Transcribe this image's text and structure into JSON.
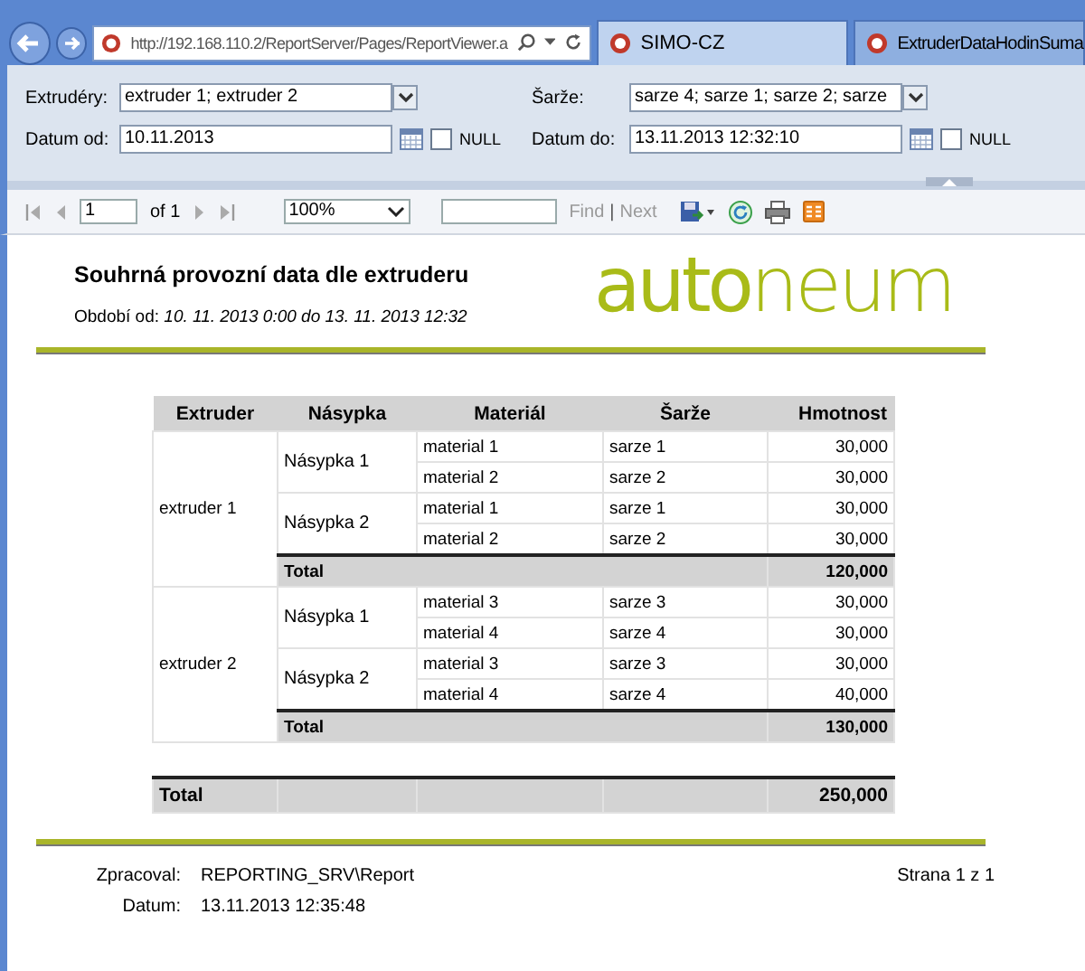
{
  "browser": {
    "address": "http://192.168.110.2/ReportServer/Pages/ReportViewer.a",
    "tabs": [
      {
        "label": "SIMO-CZ",
        "selected": true
      },
      {
        "label": "ExtruderDataHodinSuma",
        "selected": false
      }
    ]
  },
  "parameters": [
    {
      "label": "Extrudéry:",
      "value": "extruder 1; extruder 2",
      "kind": "dropdown"
    },
    {
      "label": "Šarže:",
      "value": "sarze 4; sarze 1; sarze 2; sarze",
      "kind": "dropdown"
    },
    {
      "label": "Datum od:",
      "value": "10.11.2013",
      "kind": "date",
      "null_label": "NULL",
      "null_checked": false
    },
    {
      "label": "Datum do:",
      "value": "13.11.2013 12:32:10",
      "kind": "date",
      "null_label": "NULL",
      "null_checked": false
    }
  ],
  "toolbar": {
    "page": "1",
    "of": "of 1",
    "zoom": "100%",
    "find": "Find",
    "separator": "|",
    "next": "Next"
  },
  "report": {
    "title": "Souhrná provozní data dle extruderu",
    "logo": "**auto**neum",
    "period_label": "Období od:",
    "period": "10. 11. 2013 0:00 do 13. 11. 2013 12:32",
    "table": {
      "columns": [
        "Extruder",
        "Násypka",
        "Materiál",
        "Šarže",
        "Hmotnost"
      ],
      "groups": [
        {
          "extruder": "extruder 1",
          "hoppers": [
            {
              "name": "Násypka 1",
              "rows": [
                {
                  "material": "material 1",
                  "batch": "sarze 1",
                  "weight": "30,000"
                },
                {
                  "material": "material 2",
                  "batch": "sarze 2",
                  "weight": "30,000"
                }
              ]
            },
            {
              "name": "Násypka 2",
              "rows": [
                {
                  "material": "material 1",
                  "batch": "sarze 1",
                  "weight": "30,000"
                },
                {
                  "material": "material 2",
                  "batch": "sarze 2",
                  "weight": "30,000"
                }
              ]
            }
          ],
          "total_label": "Total",
          "total": "120,000"
        },
        {
          "extruder": "extruder 2",
          "hoppers": [
            {
              "name": "Násypka 1",
              "rows": [
                {
                  "material": "material 3",
                  "batch": "sarze 3",
                  "weight": "30,000"
                },
                {
                  "material": "material 4",
                  "batch": "sarze 4",
                  "weight": "30,000"
                }
              ]
            },
            {
              "name": "Násypka 2",
              "rows": [
                {
                  "material": "material 3",
                  "batch": "sarze 3",
                  "weight": "30,000"
                },
                {
                  "material": "material 4",
                  "batch": "sarze 4",
                  "weight": "40,000"
                }
              ]
            }
          ],
          "total_label": "Total",
          "total": "130,000"
        }
      ],
      "grand_total_label": "Total",
      "grand_total": "250,000"
    },
    "footer": {
      "processed_label": "Zpracoval:",
      "processed": "REPORTING_SRV\\Report",
      "date_label": "Datum:",
      "date": "13.11.2013 12:35:48",
      "page": "Strana 1 z 1"
    }
  }
}
